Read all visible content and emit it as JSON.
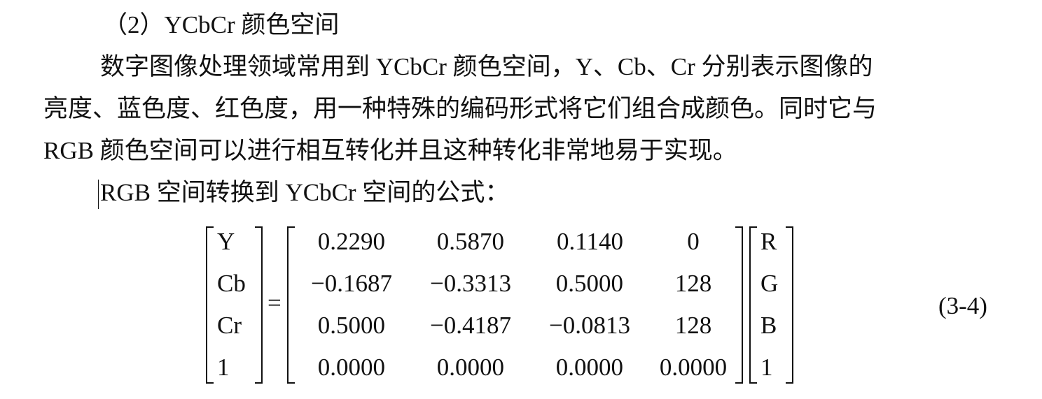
{
  "section": {
    "heading": "（2）YCbCr 颜色空间"
  },
  "paragraph": {
    "line1": "数字图像处理领域常用到 YCbCr 颜色空间，Y、Cb、Cr 分别表示图像的",
    "line2": "亮度、蓝色度、红色度，用一种特殊的编码形式将它们组合成颜色。同时它与",
    "line3": "RGB 颜色空间可以进行相互转化并且这种转化非常地易于实现。"
  },
  "formula_intro": "RGB 空间转换到 YCbCr 空间的公式：",
  "equation": {
    "lhs": [
      "Y",
      "Cb",
      "Cr",
      "1"
    ],
    "equals": "=",
    "matrix": [
      [
        "0.2290",
        "0.5870",
        "0.1140",
        "0"
      ],
      [
        "−0.1687",
        "−0.3313",
        "0.5000",
        "128"
      ],
      [
        "0.5000",
        "−0.4187",
        "−0.0813",
        "128"
      ],
      [
        "0.0000",
        "0.0000",
        "0.0000",
        "0.0000"
      ]
    ],
    "rhs": [
      "R",
      "G",
      "B",
      "1"
    ],
    "number": "(3-4)"
  }
}
